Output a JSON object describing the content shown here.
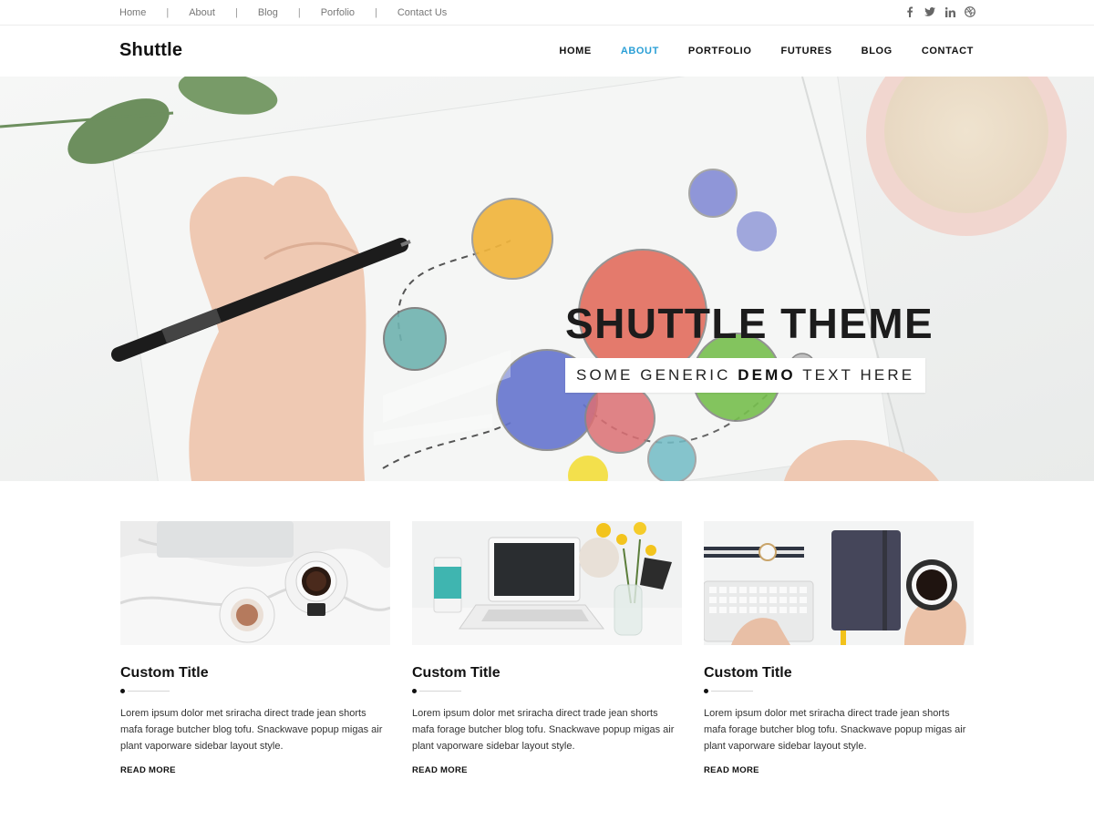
{
  "topbar": {
    "links": [
      "Home",
      "About",
      "Blog",
      "Porfolio",
      "Contact Us"
    ],
    "separator": "|",
    "social": [
      "facebook-icon",
      "twitter-icon",
      "linkedin-icon",
      "dribbble-icon"
    ]
  },
  "header": {
    "logo": "Shuttle",
    "nav": [
      {
        "label": "HOME",
        "active": false
      },
      {
        "label": "ABOUT",
        "active": true
      },
      {
        "label": "PORTFOLIO",
        "active": false
      },
      {
        "label": "FUTURES",
        "active": false
      },
      {
        "label": "BLOG",
        "active": false
      },
      {
        "label": "CONTACT",
        "active": false
      }
    ],
    "accent_color": "#2a9fd6"
  },
  "hero": {
    "title": "SHUTTLE THEME",
    "subtitle_before": "SOME GENERIC ",
    "subtitle_bold": "DEMO",
    "subtitle_after": " TEXT HERE"
  },
  "cards": [
    {
      "title": "Custom Title",
      "text": "Lorem ipsum dolor met sriracha direct trade jean shorts mafa forage butcher blog tofu. Snackwave popup migas air plant vaporware sidebar layout style.",
      "link": "READ MORE"
    },
    {
      "title": "Custom Title",
      "text": "Lorem ipsum dolor met sriracha direct trade jean shorts mafa forage butcher blog tofu. Snackwave popup migas air plant vaporware sidebar layout style.",
      "link": "READ MORE"
    },
    {
      "title": "Custom Title",
      "text": "Lorem ipsum dolor met sriracha direct trade jean shorts mafa forage butcher blog tofu. Snackwave popup migas air plant vaporware sidebar layout style.",
      "link": "READ MORE"
    }
  ]
}
